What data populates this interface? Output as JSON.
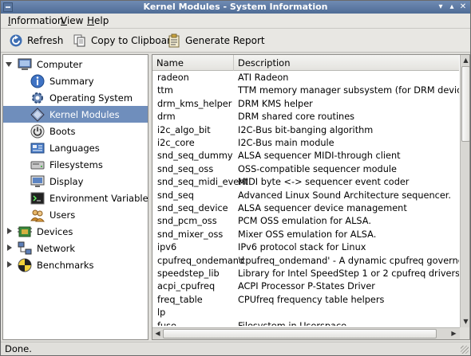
{
  "window": {
    "title": "Kernel Modules - System Information"
  },
  "menubar": {
    "items": [
      {
        "label": "Information",
        "mnemonic": "I"
      },
      {
        "label": "View",
        "mnemonic": "V"
      },
      {
        "label": "Help",
        "mnemonic": "H"
      }
    ]
  },
  "toolbar": {
    "refresh": {
      "label": "Refresh",
      "icon": "refresh-icon"
    },
    "copy": {
      "label": "Copy to Clipboard",
      "icon": "copy-icon"
    },
    "report": {
      "label": "Generate Report",
      "icon": "report-icon"
    }
  },
  "sidebar": {
    "items": [
      {
        "label": "Computer",
        "level": 0,
        "expanded": true,
        "icon": "computer-icon"
      },
      {
        "label": "Summary",
        "level": 1,
        "icon": "info-icon"
      },
      {
        "label": "Operating System",
        "level": 1,
        "icon": "gear-icon"
      },
      {
        "label": "Kernel Modules",
        "level": 1,
        "icon": "module-icon",
        "selected": true
      },
      {
        "label": "Boots",
        "level": 1,
        "icon": "power-icon"
      },
      {
        "label": "Languages",
        "level": 1,
        "icon": "languages-icon"
      },
      {
        "label": "Filesystems",
        "level": 1,
        "icon": "filesystem-icon"
      },
      {
        "label": "Display",
        "level": 1,
        "icon": "display-icon"
      },
      {
        "label": "Environment Variables",
        "level": 1,
        "icon": "terminal-icon"
      },
      {
        "label": "Users",
        "level": 1,
        "icon": "users-icon"
      },
      {
        "label": "Devices",
        "level": 0,
        "expanded": false,
        "icon": "devices-icon"
      },
      {
        "label": "Network",
        "level": 0,
        "expanded": false,
        "icon": "network-icon"
      },
      {
        "label": "Benchmarks",
        "level": 0,
        "expanded": false,
        "icon": "benchmark-icon"
      }
    ]
  },
  "table": {
    "columns": [
      "Name",
      "Description"
    ],
    "rows": [
      [
        "radeon",
        "ATI Radeon"
      ],
      [
        "ttm",
        "TTM memory manager subsystem (for DRM device)"
      ],
      [
        "drm_kms_helper",
        "DRM KMS helper"
      ],
      [
        "drm",
        "DRM shared core routines"
      ],
      [
        "i2c_algo_bit",
        "I2C-Bus bit-banging algorithm"
      ],
      [
        "i2c_core",
        "I2C-Bus main module"
      ],
      [
        "snd_seq_dummy",
        "ALSA sequencer MIDI-through client"
      ],
      [
        "snd_seq_oss",
        "OSS-compatible sequencer module"
      ],
      [
        "snd_seq_midi_event",
        "MIDI byte <-> sequencer event coder"
      ],
      [
        "snd_seq",
        "Advanced Linux Sound Architecture sequencer."
      ],
      [
        "snd_seq_device",
        "ALSA sequencer device management"
      ],
      [
        "snd_pcm_oss",
        "PCM OSS emulation for ALSA."
      ],
      [
        "snd_mixer_oss",
        "Mixer OSS emulation for ALSA."
      ],
      [
        "ipv6",
        "IPv6 protocol stack for Linux"
      ],
      [
        "cpufreq_ondemand",
        "'cpufreq_ondemand' - A dynamic cpufreq governor for Low L"
      ],
      [
        "speedstep_lib",
        "Library for Intel SpeedStep 1 or 2 cpufreq drivers."
      ],
      [
        "acpi_cpufreq",
        "ACPI Processor P-States Driver"
      ],
      [
        "freq_table",
        "CPUfreq frequency table helpers"
      ],
      [
        "lp",
        ""
      ],
      [
        "fuse",
        "Filesystem in Userspace"
      ]
    ]
  },
  "status": {
    "text": "Done."
  },
  "colors": {
    "selection": "#6f8ebc",
    "titlebar": "#5a77a1"
  }
}
